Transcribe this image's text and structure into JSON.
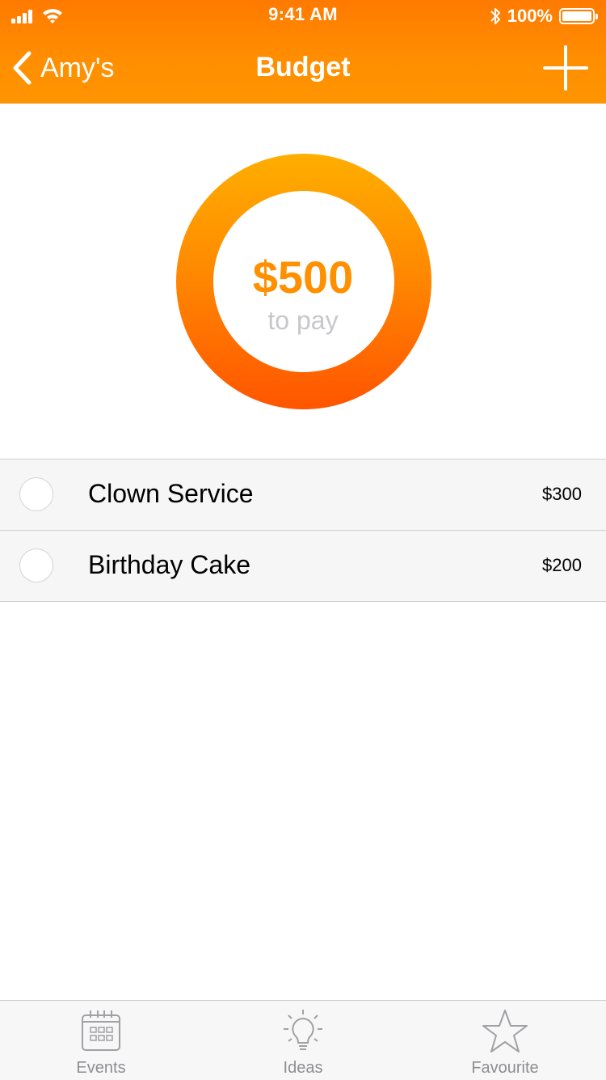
{
  "status_bar": {
    "time": "9:41 AM",
    "battery": "100%"
  },
  "nav": {
    "back_label": "Amy's",
    "title": "Budget"
  },
  "summary": {
    "amount": "$500",
    "caption": "to pay"
  },
  "items": [
    {
      "title": "Clown Service",
      "price": "$300"
    },
    {
      "title": "Birthday Cake",
      "price": "$200"
    }
  ],
  "tabs": [
    {
      "label": "Events",
      "icon": "calendar-icon"
    },
    {
      "label": "Ideas",
      "icon": "lightbulb-icon"
    },
    {
      "label": "Favourite",
      "icon": "star-icon"
    }
  ],
  "colors": {
    "accent": "#ff8f00",
    "donut_top": "#ffae00",
    "donut_bottom": "#ff5500"
  }
}
